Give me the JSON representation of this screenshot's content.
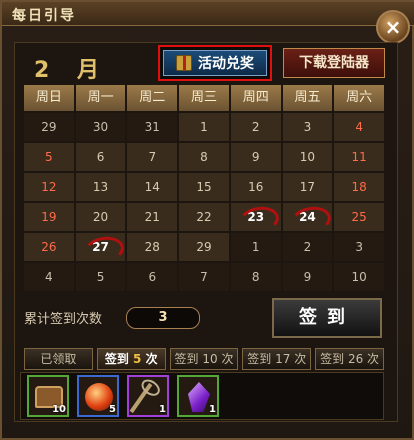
{
  "window": {
    "title": "每日引导"
  },
  "header": {
    "month_num": "2",
    "month_unit": "月",
    "activity_button": "活动兑奖",
    "download_button": "下载登陆器"
  },
  "calendar": {
    "weekdays": [
      "周日",
      "周一",
      "周二",
      "周三",
      "周四",
      "周五",
      "周六"
    ],
    "weeks": [
      [
        "29",
        "30",
        "31",
        "1",
        "2",
        "3",
        "4"
      ],
      [
        "5",
        "6",
        "7",
        "8",
        "9",
        "10",
        "11"
      ],
      [
        "12",
        "13",
        "14",
        "15",
        "16",
        "17",
        "18"
      ],
      [
        "19",
        "20",
        "21",
        "22",
        "23",
        "24",
        "25"
      ],
      [
        "26",
        "27",
        "28",
        "29",
        "1",
        "2",
        "3"
      ],
      [
        "4",
        "5",
        "6",
        "7",
        "8",
        "9",
        "10"
      ]
    ],
    "signed_days": [
      "23",
      "24",
      "27"
    ]
  },
  "summary": {
    "label": "累计签到次数",
    "value": "3",
    "sign_button": "签到"
  },
  "tabs": [
    {
      "label": "已领取"
    },
    {
      "label_prefix": "签到",
      "num": "5",
      "label_suffix": "次"
    },
    {
      "label_prefix": "签到",
      "num": "10",
      "label_suffix": "次"
    },
    {
      "label_prefix": "签到",
      "num": "17",
      "label_suffix": "次"
    },
    {
      "label_prefix": "签到",
      "num": "26",
      "label_suffix": "次"
    }
  ],
  "rewards": [
    {
      "icon": "chest-icon",
      "count": "10"
    },
    {
      "icon": "orb-icon",
      "count": "5"
    },
    {
      "icon": "staff-icon",
      "count": "1"
    },
    {
      "icon": "crystal-icon",
      "count": "1"
    }
  ]
}
